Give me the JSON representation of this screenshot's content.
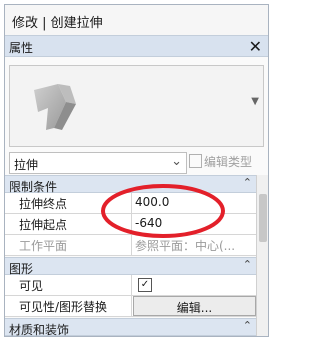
{
  "title": "修改 | 创建拉伸",
  "properties_header": {
    "label": "属性",
    "close": "✕"
  },
  "type_selector": {
    "value": "拉伸",
    "edit_type_label": "编辑类型"
  },
  "groups": {
    "constraints": "限制条件",
    "graphics": "图形",
    "materials": "材质和装饰"
  },
  "constraints_rows": [
    {
      "name": "拉伸终点",
      "value": "400.0"
    },
    {
      "name": "拉伸起点",
      "value": "-640"
    },
    {
      "name": "工作平面",
      "value": "参照平面：中心(..."
    }
  ],
  "graphics_rows": {
    "visible": {
      "name": "可见",
      "checked": true
    },
    "visibility_override": {
      "name": "可见性/图形替换",
      "button": "编辑..."
    }
  },
  "colors": {
    "annotation_red": "#e3202a",
    "header_blue": "#d8e2ef"
  }
}
